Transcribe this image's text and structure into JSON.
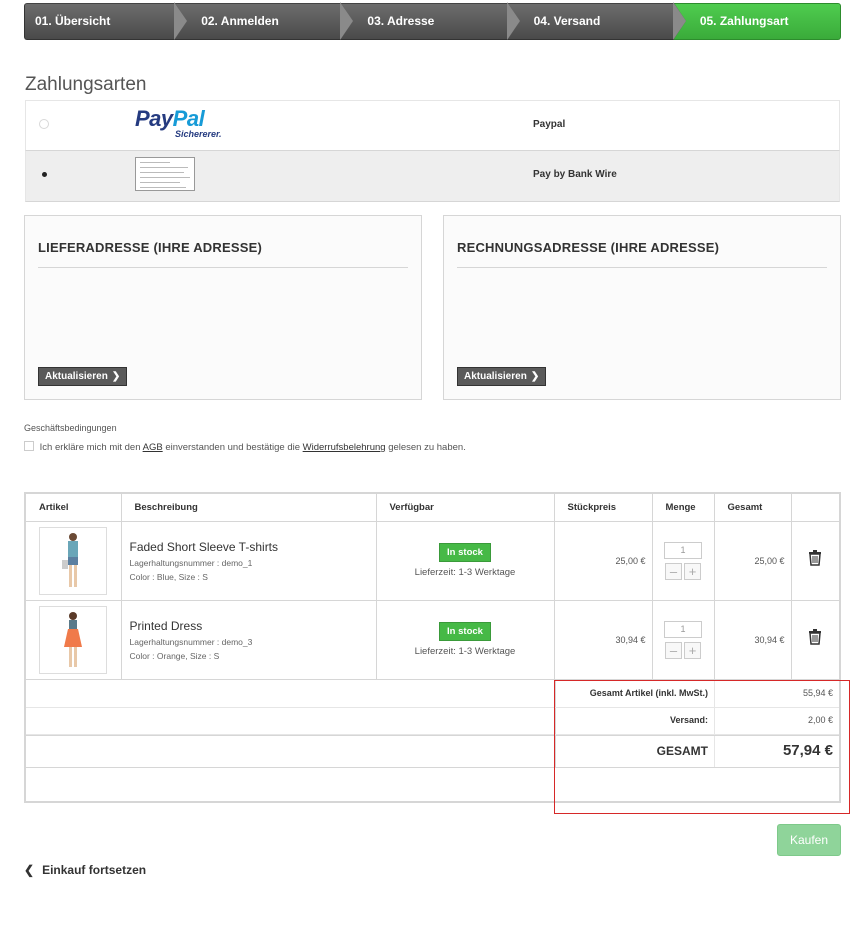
{
  "steps": [
    {
      "label": "01. Übersicht"
    },
    {
      "label": "02. Anmelden"
    },
    {
      "label": "03. Adresse"
    },
    {
      "label": "04. Versand"
    },
    {
      "label": "05. Zahlungsart"
    }
  ],
  "payment": {
    "title": "Zahlungsarten",
    "options": [
      {
        "label": "Paypal",
        "logo_text_1": "Pay",
        "logo_text_2": "Pal",
        "logo_sub": "Sichererer.",
        "selected": false
      },
      {
        "label": "Pay by Bank Wire",
        "selected": true
      }
    ]
  },
  "addresses": {
    "delivery_title": "LIEFERADRESSE (IHRE ADRESSE)",
    "invoice_title": "RECHNUNGSADRESSE (IHRE ADRESSE)",
    "update_label": "Aktualisieren"
  },
  "terms": {
    "heading": "Geschäftsbedingungen",
    "text_1": "Ich erkläre mich mit den",
    "agb": "AGB",
    "text_2": "einverstanden und bestätige die",
    "widerruf": "Widerrufsbelehrung",
    "text_3": "gelesen zu haben."
  },
  "cart": {
    "headers": [
      "Artikel",
      "Beschreibung",
      "Verfügbar",
      "Stückpreis",
      "Menge",
      "Gesamt"
    ],
    "items": [
      {
        "name": "Faded Short Sleeve T-shirts",
        "sku": "Lagerhaltungsnummer : demo_1",
        "attr": "Color : Blue, Size : S",
        "stock": "In stock",
        "delivery": "Lieferzeit: 1-3 Werktage",
        "unit_price": "25,00 €",
        "qty": "1",
        "total": "25,00 €",
        "color": "#6aa6b8"
      },
      {
        "name": "Printed Dress",
        "sku": "Lagerhaltungsnummer : demo_3",
        "attr": "Color : Orange, Size : S",
        "stock": "In stock",
        "delivery": "Lieferzeit: 1-3 Werktage",
        "unit_price": "30,94 €",
        "qty": "1",
        "total": "30,94 €",
        "color": "#f07a4a"
      }
    ],
    "summary": {
      "products_label": "Gesamt Artikel (inkl. MwSt.)",
      "products_value": "55,94 €",
      "shipping_label": "Versand:",
      "shipping_value": "2,00 €",
      "total_label": "GESAMT",
      "total_value": "57,94 €"
    }
  },
  "buy_label": "Kaufen",
  "continue_label": "Einkauf fortsetzen",
  "colors": {
    "active_step": "#3fb83f",
    "buy_button": "#8fd49a",
    "highlight": "#d62828"
  }
}
